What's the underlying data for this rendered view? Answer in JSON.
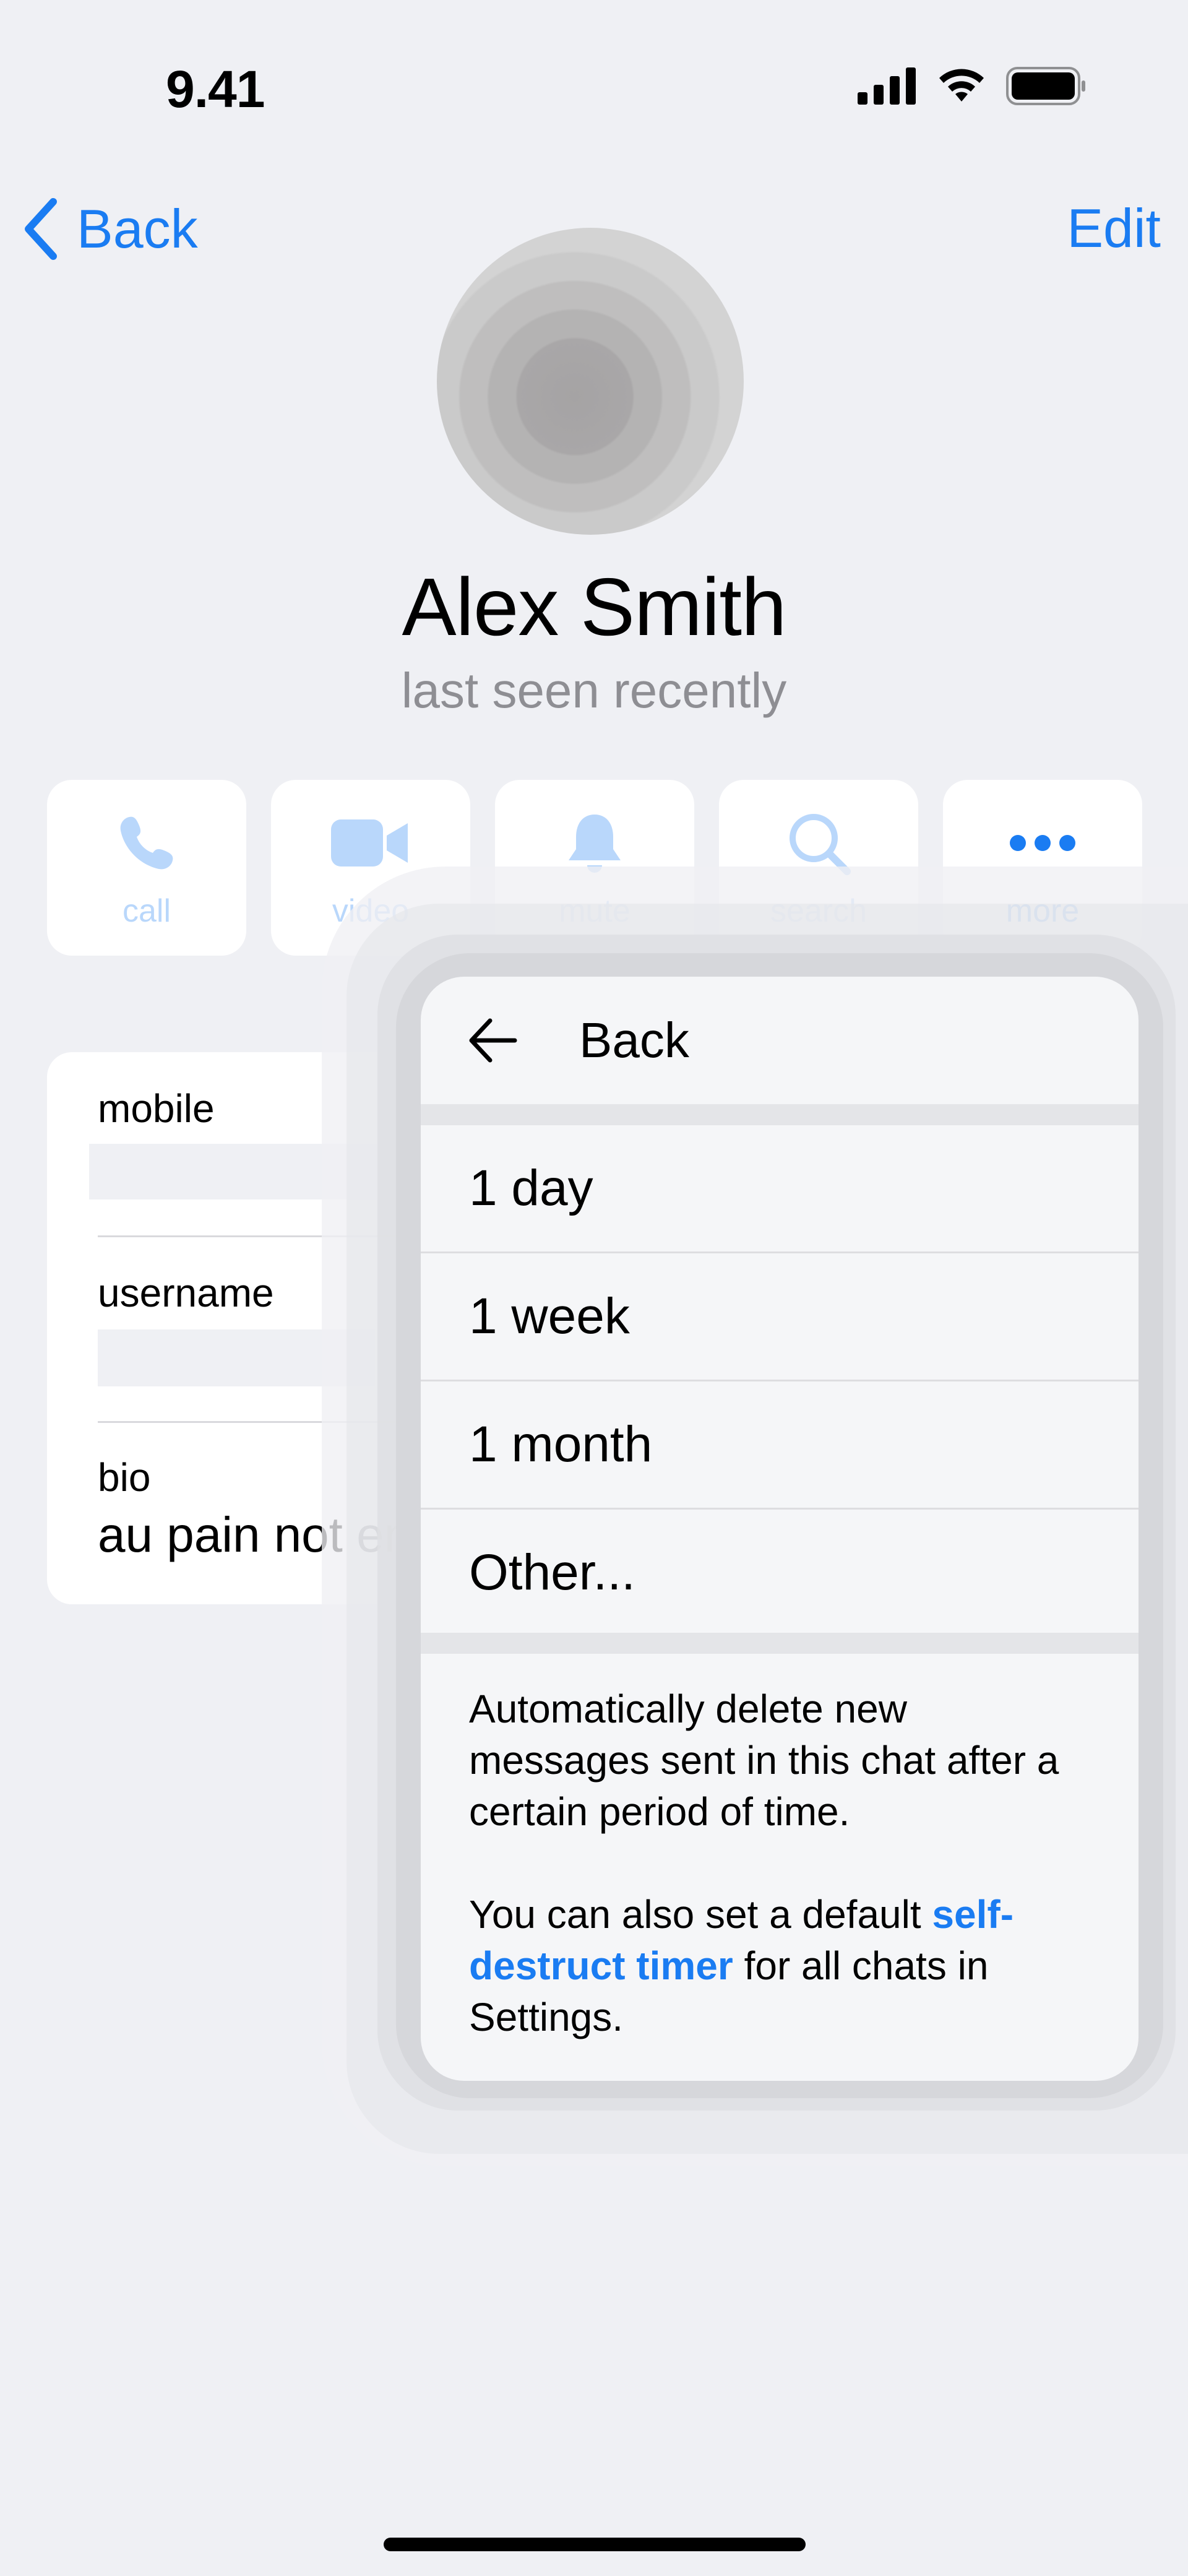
{
  "status_bar": {
    "time": "9.41"
  },
  "nav": {
    "back_label": "Back",
    "edit_label": "Edit"
  },
  "profile": {
    "name": "Alex Smith",
    "status": "last seen recently"
  },
  "actions": [
    {
      "label": "call",
      "icon": "phone-icon"
    },
    {
      "label": "video",
      "icon": "video-camera-icon"
    },
    {
      "label": "mute",
      "icon": "bell-icon"
    },
    {
      "label": "search",
      "icon": "search-icon"
    },
    {
      "label": "more",
      "icon": "ellipsis-icon"
    }
  ],
  "info": {
    "mobile_label": "mobile",
    "username_label": "username",
    "bio_label": "bio",
    "bio_value": "au pain not en"
  },
  "menu": {
    "back_label": "Back",
    "options": [
      "1 day",
      "1 week",
      "1 month",
      "Other..."
    ],
    "description": "Automatically delete new messages sent in this chat after a certain period of time.",
    "note_prefix": "You can also set a default ",
    "note_link": "self-destruct timer",
    "note_suffix": " for all chats in Settings."
  },
  "colors": {
    "accent": "#1a7cf2",
    "background": "#eff0f4"
  }
}
